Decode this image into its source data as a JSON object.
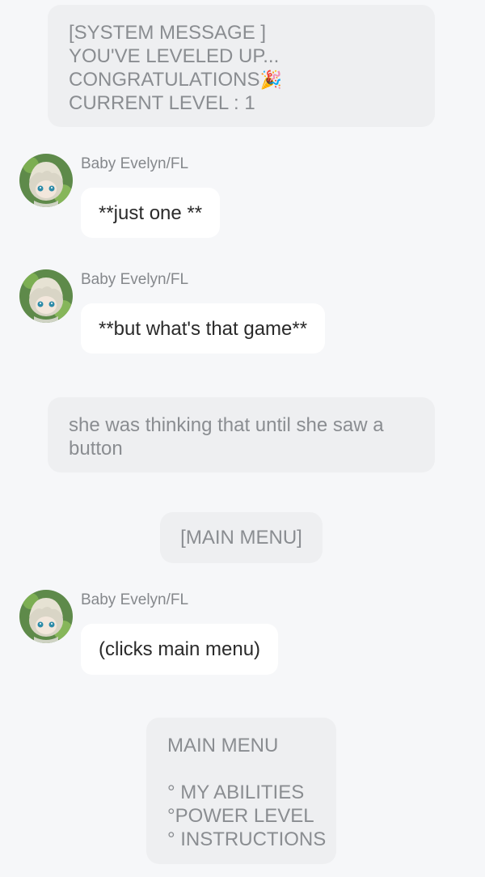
{
  "messages": {
    "system_1": {
      "lines": [
        "[SYSTEM MESSAGE ]",
        "YOU'VE LEVELED UP...",
        "CONGRATULATIONS",
        "CURRENT LEVEL : 1"
      ],
      "emoji": "🎉"
    },
    "chat_1": {
      "author": "Baby Evelyn/FL",
      "text": "**just one **"
    },
    "chat_2": {
      "author": "Baby Evelyn/FL",
      "text": "**but what's that game**"
    },
    "narration_1": {
      "lines": [
        "she was thinking that until she saw a",
        "button"
      ]
    },
    "system_2": {
      "text": "[MAIN MENU]"
    },
    "chat_3": {
      "author": "Baby Evelyn/FL",
      "text": "(clicks main menu)"
    },
    "system_3": {
      "lines": [
        "MAIN MENU",
        "",
        "° MY ABILITIES",
        "°POWER LEVEL",
        "° INSTRUCTIONS"
      ]
    }
  },
  "colors": {
    "background": "#f6f7f9",
    "system_bubble": "#eeeff1",
    "system_text": "#8a8d91",
    "chat_bubble": "#ffffff",
    "chat_text": "#2a2a2a",
    "author_text": "#85888c"
  },
  "icons": {
    "avatar": "anime-girl-avatar"
  }
}
